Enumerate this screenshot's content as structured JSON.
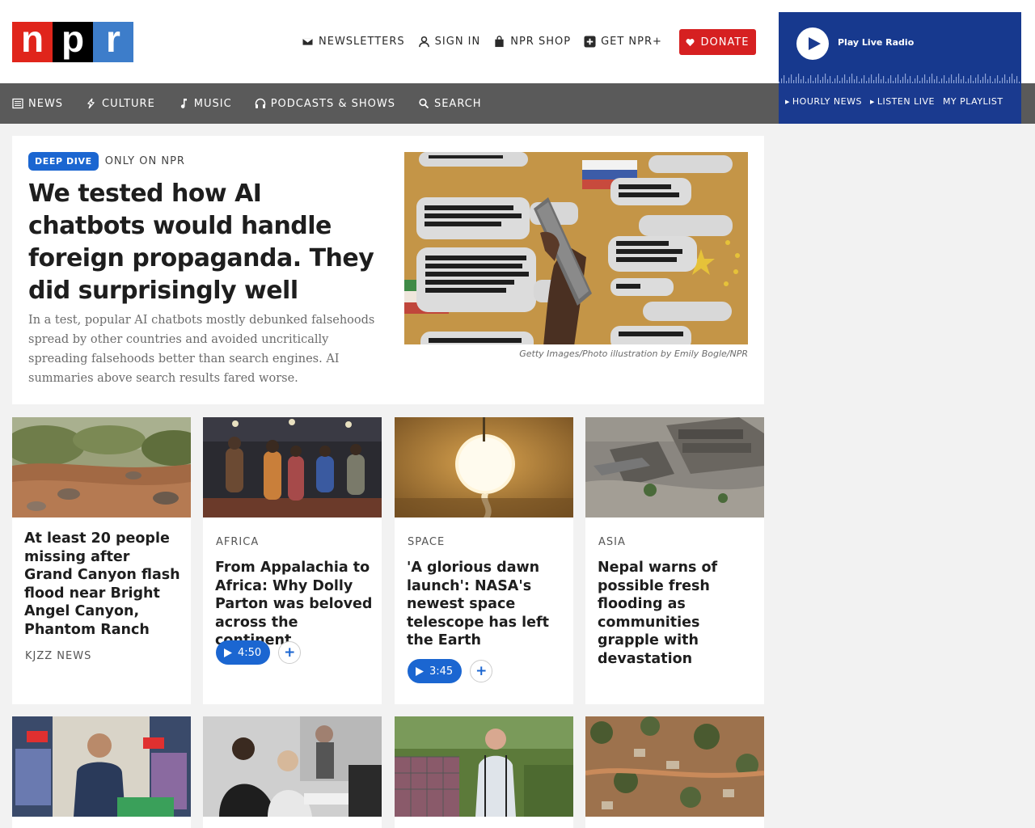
{
  "logo": {
    "letters": [
      "n",
      "p",
      "r"
    ]
  },
  "utility": {
    "newsletters": "NEWSLETTERS",
    "sign_in": "SIGN IN",
    "shop": "NPR SHOP",
    "plus": "GET NPR+",
    "donate": "DONATE"
  },
  "nav": {
    "items": [
      {
        "label": "NEWS",
        "icon": "newspaper-icon"
      },
      {
        "label": "CULTURE",
        "icon": "culture-icon"
      },
      {
        "label": "MUSIC",
        "icon": "music-note-icon"
      },
      {
        "label": "PODCASTS & SHOWS",
        "icon": "headphones-icon"
      },
      {
        "label": "SEARCH",
        "icon": "search-icon"
      }
    ]
  },
  "radio": {
    "play_label": "Play Live Radio",
    "links": [
      "HOURLY NEWS",
      "LISTEN LIVE",
      "MY PLAYLIST"
    ]
  },
  "featured": {
    "tag": "DEEP DIVE",
    "kicker": "ONLY ON NPR",
    "title": "We tested how AI chatbots would handle foreign propaganda. They did surprisingly well",
    "teaser": "In a test, popular AI chatbots mostly debunked falsehoods spread by other countries and avoided uncritically spreading falsehoods better than search engines. AI summaries above search results fared worse.",
    "credit": "Getty Images/Photo illustration by Emily Bogle/NPR"
  },
  "cards": [
    {
      "slug": "",
      "title": "At least 20 people missing after Grand Canyon flash flood near Bright Angel Canyon, Phantom Ranch",
      "byline": "KJZZ NEWS",
      "duration": ""
    },
    {
      "slug": "AFRICA",
      "title": "From Appalachia to Africa: Why Dolly Parton was beloved across the continent",
      "byline": "",
      "duration": "4:50"
    },
    {
      "slug": "SPACE",
      "title": "'A glorious dawn launch': NASA's newest space telescope has left the Earth",
      "byline": "",
      "duration": "3:45"
    },
    {
      "slug": "ASIA",
      "title": "Nepal warns of possible fresh flooding as communities grapple with devastation",
      "byline": "",
      "duration": ""
    }
  ],
  "colors": {
    "npr_red": "#e0251b",
    "npr_blue": "#3d7dca",
    "donate": "#d62021",
    "accent": "#1b66d1",
    "radio": "#1a3a8f",
    "nav": "#5a5a5a"
  }
}
